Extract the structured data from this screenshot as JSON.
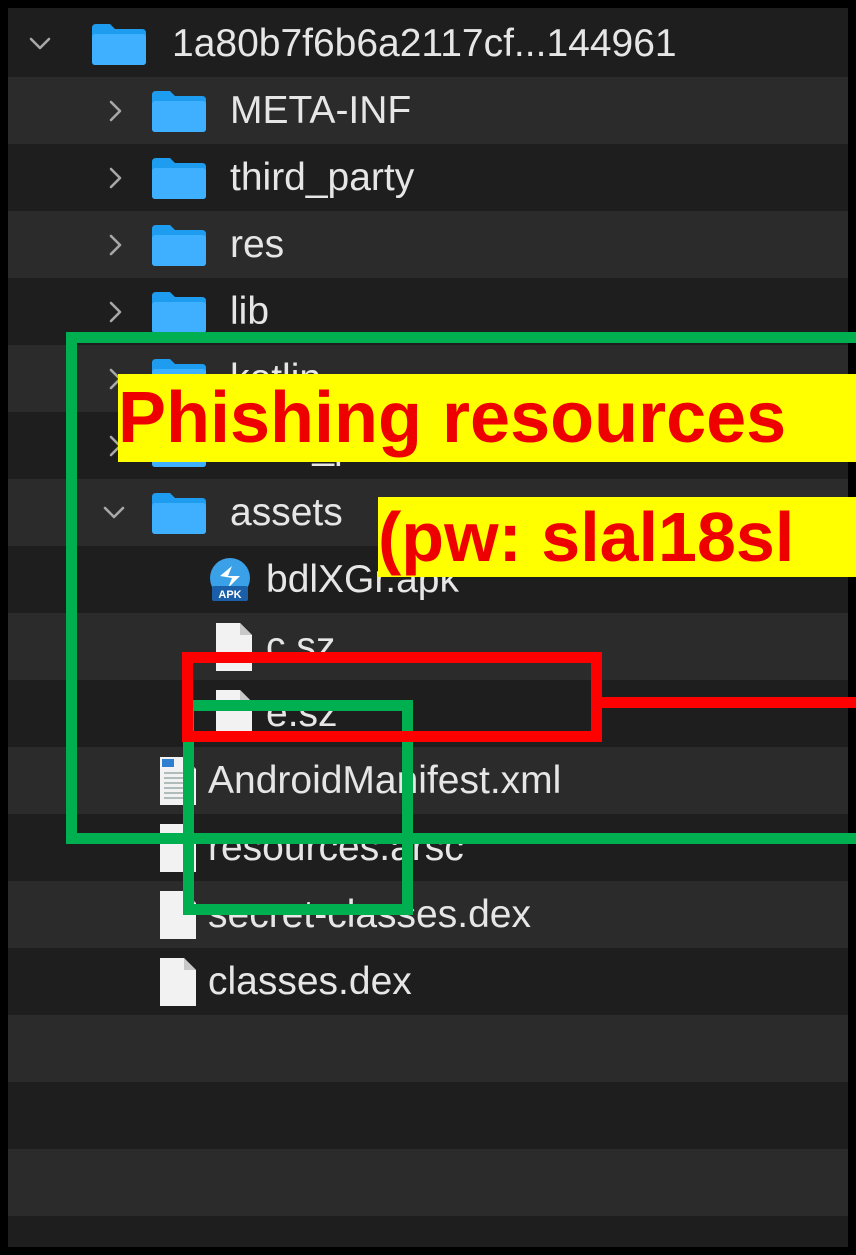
{
  "tree": {
    "root": {
      "name": "1a80b7f6b6a2117cf...144961",
      "expanded": true
    },
    "items": [
      {
        "name": "META-INF",
        "type": "folder"
      },
      {
        "name": "third_party",
        "type": "folder"
      },
      {
        "name": "res",
        "type": "folder"
      },
      {
        "name": "lib",
        "type": "folder"
      },
      {
        "name": "kotlin",
        "type": "folder"
      },
      {
        "name": "error_prone",
        "type": "folder"
      },
      {
        "name": "assets",
        "type": "folder",
        "expanded": true
      },
      {
        "name": "bdlXGr.apk",
        "type": "apk",
        "icon_badge": "APK"
      },
      {
        "name": "c.sz",
        "type": "file"
      },
      {
        "name": "e.sz",
        "type": "file"
      },
      {
        "name": "AndroidManifest.xml",
        "type": "xml"
      },
      {
        "name": "resources.arsc",
        "type": "file"
      },
      {
        "name": "secret-classes.dex",
        "type": "file"
      },
      {
        "name": "classes.dex",
        "type": "file"
      }
    ]
  },
  "annotation": {
    "line1": "Phishing resources",
    "line2": "(pw: slal18sl",
    "colors": {
      "text": "#ee0000",
      "background": "#ffff00",
      "green_box": "#00b050",
      "red_box": "#ff0000"
    }
  },
  "colors": {
    "panel": "#1e1e1e",
    "row_alt": "#2b2b2b",
    "folder": "#1e9cf0",
    "text": "#e6e6e6"
  },
  "icons": {
    "chevron_right": "chevron-right-icon",
    "chevron_down": "chevron-down-icon",
    "folder": "folder-icon",
    "file": "document-icon",
    "apk": "apk-icon",
    "xml": "xml-document-icon"
  }
}
